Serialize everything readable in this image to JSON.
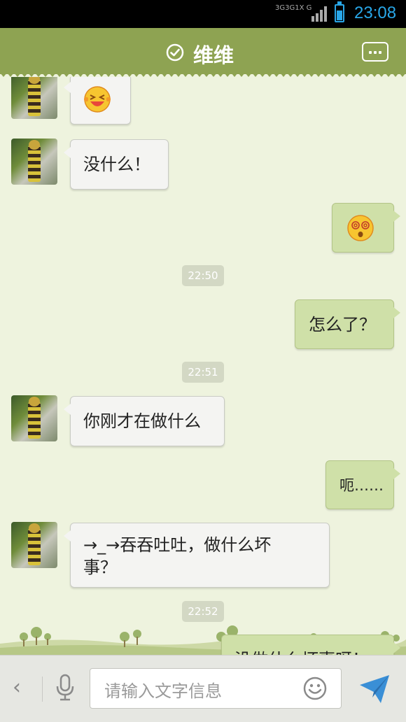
{
  "status_bar": {
    "network_labels": [
      "3G",
      "3G",
      "1X",
      "G"
    ],
    "time": "23:08",
    "accent_color": "#29a7e8"
  },
  "header": {
    "title": "维维",
    "status_icon": "check-circle-icon",
    "menu_icon": "more-dots-icon",
    "background_color": "#8ea352"
  },
  "messages": [
    {
      "side": "left",
      "type": "emoji",
      "emoji": "laughing-face-emoji"
    },
    {
      "side": "left",
      "type": "text",
      "text": "没什么！"
    },
    {
      "side": "right",
      "type": "emoji",
      "emoji": "dizzy-face-emoji"
    },
    {
      "type": "time",
      "text": "22:50"
    },
    {
      "side": "right",
      "type": "text",
      "text": "怎么了？"
    },
    {
      "type": "time",
      "text": "22:51"
    },
    {
      "side": "left",
      "type": "text",
      "text": "你刚才在做什么"
    },
    {
      "side": "right",
      "type": "text",
      "text": "呃……"
    },
    {
      "side": "left",
      "type": "text",
      "text": "→_→吞吞吐吐，做什么坏事？"
    },
    {
      "type": "time",
      "text": "22:52"
    },
    {
      "side": "right",
      "type": "text",
      "text": "没做什么坏事呀！"
    }
  ],
  "input_bar": {
    "back_icon": "chevron-left-icon",
    "mic_icon": "microphone-icon",
    "placeholder": "请输入文字信息",
    "emoji_icon": "smiley-icon",
    "send_icon": "send-icon"
  }
}
